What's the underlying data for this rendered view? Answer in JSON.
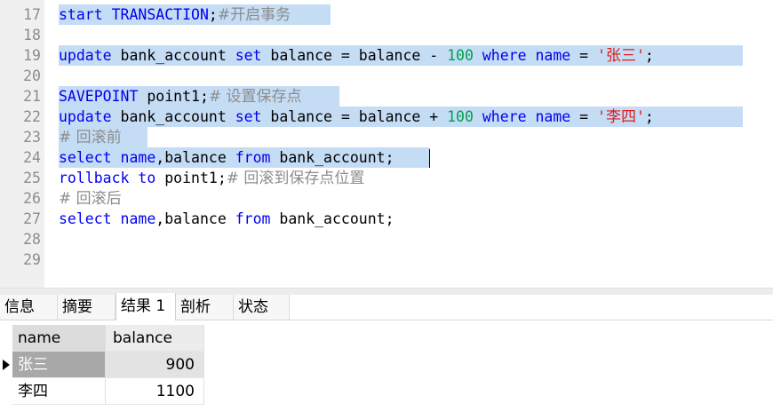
{
  "editor": {
    "lines": [
      {
        "num": "17",
        "selected": true,
        "parts": [
          [
            "kw",
            "start TRANSACTION"
          ],
          [
            "plain",
            ";"
          ],
          [
            "cmt cn",
            "#开启事务"
          ]
        ]
      },
      {
        "num": "18",
        "selected": true,
        "parts": []
      },
      {
        "num": "19",
        "selected": true,
        "parts": [
          [
            "kw",
            "update"
          ],
          [
            "plain",
            " bank_account "
          ],
          [
            "kw",
            "set"
          ],
          [
            "plain",
            " balance = balance - "
          ],
          [
            "num",
            "100"
          ],
          [
            "plain",
            " "
          ],
          [
            "kw",
            "where"
          ],
          [
            "plain",
            " "
          ],
          [
            "kw",
            "name"
          ],
          [
            "plain",
            " = "
          ],
          [
            "str",
            "'"
          ],
          [
            "str cn",
            "张三"
          ],
          [
            "str",
            "'"
          ],
          [
            "plain",
            ";"
          ]
        ]
      },
      {
        "num": "20",
        "selected": true,
        "parts": []
      },
      {
        "num": "21",
        "selected": true,
        "parts": [
          [
            "kw",
            "SAVEPOINT"
          ],
          [
            "plain",
            " point1;"
          ],
          [
            "cmt cn",
            "# 设置保存点"
          ]
        ]
      },
      {
        "num": "22",
        "selected": true,
        "parts": [
          [
            "kw",
            "update"
          ],
          [
            "plain",
            " bank_account "
          ],
          [
            "kw",
            "set"
          ],
          [
            "plain",
            " balance = balance + "
          ],
          [
            "num",
            "100"
          ],
          [
            "plain",
            " "
          ],
          [
            "kw",
            "where"
          ],
          [
            "plain",
            " "
          ],
          [
            "kw",
            "name"
          ],
          [
            "plain",
            " = "
          ],
          [
            "str",
            "'"
          ],
          [
            "str cn",
            "李四"
          ],
          [
            "str",
            "'"
          ],
          [
            "plain",
            ";"
          ]
        ]
      },
      {
        "num": "23",
        "selected": true,
        "parts": [
          [
            "cmt cn",
            "# 回滚前"
          ]
        ]
      },
      {
        "num": "24",
        "selected": true,
        "parts": [
          [
            "kw",
            "select"
          ],
          [
            "plain",
            " "
          ],
          [
            "kw",
            "name"
          ],
          [
            "plain",
            ",balance "
          ],
          [
            "kw",
            "from"
          ],
          [
            "plain",
            " bank_account;"
          ]
        ]
      },
      {
        "num": "25",
        "selected": false,
        "parts": [
          [
            "kw",
            "rollback"
          ],
          [
            "plain",
            " "
          ],
          [
            "kw",
            "to"
          ],
          [
            "plain",
            " point1;"
          ],
          [
            "cmt cn",
            "# 回滚到保存点位置"
          ]
        ]
      },
      {
        "num": "26",
        "selected": false,
        "parts": [
          [
            "cmt cn",
            "# 回滚后"
          ]
        ]
      },
      {
        "num": "27",
        "selected": false,
        "parts": [
          [
            "kw",
            "select"
          ],
          [
            "plain",
            " "
          ],
          [
            "kw",
            "name"
          ],
          [
            "plain",
            ",balance "
          ],
          [
            "kw",
            "from"
          ],
          [
            "plain",
            " bank_account;"
          ]
        ]
      },
      {
        "num": "28",
        "selected": false,
        "parts": []
      },
      {
        "num": "29",
        "selected": false,
        "parts": []
      }
    ]
  },
  "tabs": [
    {
      "label": "信息",
      "active": false
    },
    {
      "label": "摘要",
      "active": false
    },
    {
      "label": "结果 1",
      "active": true
    },
    {
      "label": "剖析",
      "active": false
    },
    {
      "label": "状态",
      "active": false
    }
  ],
  "result": {
    "columns": [
      "name",
      "balance"
    ],
    "rows": [
      {
        "name": "张三",
        "balance": "900",
        "selected": true
      },
      {
        "name": "李四",
        "balance": "1100",
        "selected": false
      }
    ]
  },
  "icons": {
    "row_marker": "current-row-triangle-icon"
  }
}
